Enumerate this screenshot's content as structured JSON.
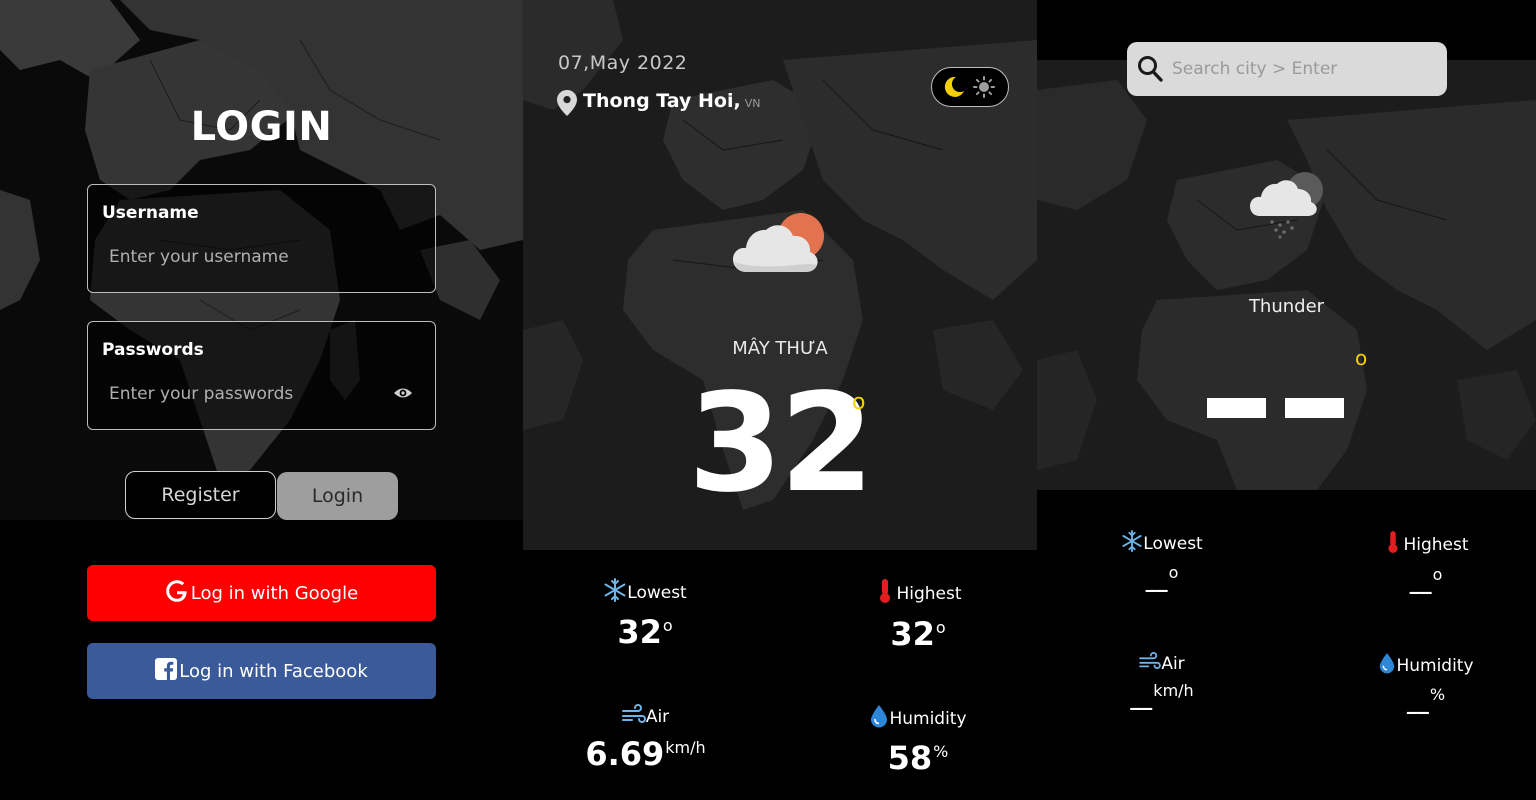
{
  "login": {
    "title": "LOGIN",
    "username": {
      "label": "Username",
      "placeholder": "Enter your username"
    },
    "password": {
      "label": "Passwords",
      "placeholder": "Enter your passwords"
    },
    "register_label": "Register",
    "login_label": "Login",
    "google_label": "Log in with Google",
    "facebook_label": "Log in with Facebook",
    "colors": {
      "google": "#fe0000",
      "facebook": "#3b5a9a",
      "login_button": "#9e9e9e"
    }
  },
  "weather": {
    "date": "07,May 2022",
    "city": "Thong Tay Hoi,",
    "country": "VN",
    "condition": "MÂY THƯA",
    "temperature": "32",
    "degree_symbol": "o",
    "icon": "partly-cloudy-icon",
    "theme_toggle": {
      "dark_icon": "moon-icon",
      "light_icon": "sun-icon"
    },
    "stats": {
      "lowest": {
        "label": "Lowest",
        "value": "32",
        "unit": "o",
        "icon": "snowflake-icon"
      },
      "highest": {
        "label": "Highest",
        "value": "32",
        "unit": "o",
        "icon": "thermometer-icon"
      },
      "air": {
        "label": "Air",
        "value": "6.69",
        "unit": "km/h",
        "icon": "wind-icon"
      },
      "humidity": {
        "label": "Humidity",
        "value": "58",
        "unit": "%",
        "icon": "water-drop-icon"
      }
    }
  },
  "search": {
    "placeholder": "Search city > Enter",
    "condition": "Thunder",
    "degree_symbol": "o",
    "icon": "thunder-rain-cloud-icon",
    "stats": {
      "lowest": {
        "label": "Lowest",
        "value": "__",
        "unit": "o"
      },
      "highest": {
        "label": "Highest",
        "value": "__",
        "unit": "o"
      },
      "air": {
        "label": "Air",
        "value": "__",
        "unit": "km/h"
      },
      "humidity": {
        "label": "Humidity",
        "value": "__",
        "unit": "%"
      }
    }
  }
}
